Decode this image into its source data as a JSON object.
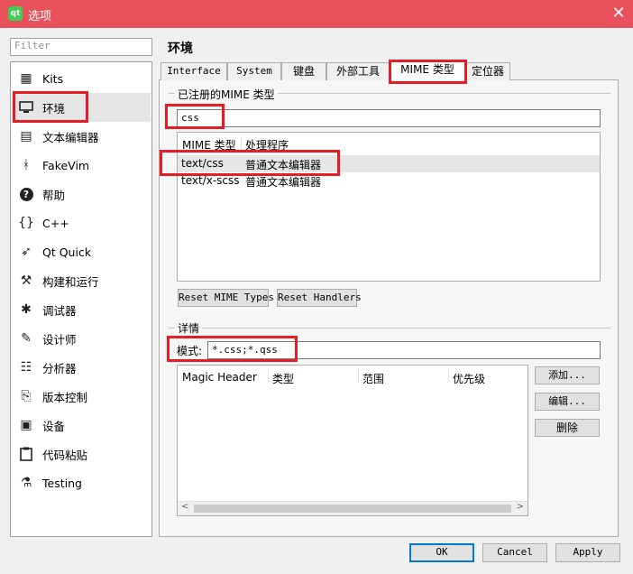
{
  "window": {
    "title": "选项",
    "app_icon": "qt-creator-icon",
    "close_glyph": "✕",
    "accent": "#e8505b"
  },
  "filter": {
    "placeholder": "Filter"
  },
  "sidebar": {
    "items": [
      {
        "label": "Kits",
        "icon": "kits-icon",
        "glyph": "▦"
      },
      {
        "label": "环境",
        "icon": "monitor-icon",
        "glyph": "▭",
        "selected": true
      },
      {
        "label": "文本编辑器",
        "icon": "text-editor-icon",
        "glyph": "▤"
      },
      {
        "label": "FakeVim",
        "icon": "fakevim-icon",
        "glyph": "ᚼ"
      },
      {
        "label": "帮助",
        "icon": "help-icon",
        "glyph": "?"
      },
      {
        "label": "C++",
        "icon": "cpp-braces-icon",
        "glyph": "{}"
      },
      {
        "label": "Qt Quick",
        "icon": "qtquick-icon",
        "glyph": "➶"
      },
      {
        "label": "构建和运行",
        "icon": "hammer-icon",
        "glyph": "⚒"
      },
      {
        "label": "调试器",
        "icon": "bug-icon",
        "glyph": "✱"
      },
      {
        "label": "设计师",
        "icon": "pencil-icon",
        "glyph": "✎"
      },
      {
        "label": "分析器",
        "icon": "analyzer-icon",
        "glyph": "☷"
      },
      {
        "label": "版本控制",
        "icon": "version-control-icon",
        "glyph": "⎘"
      },
      {
        "label": "设备",
        "icon": "device-icon",
        "glyph": "▣"
      },
      {
        "label": "代码粘贴",
        "icon": "code-paste-icon",
        "glyph": "📋"
      },
      {
        "label": "Testing",
        "icon": "flask-icon",
        "glyph": "⚗"
      }
    ]
  },
  "section_title": "环境",
  "tabs": [
    {
      "label": "Interface"
    },
    {
      "label": "System"
    },
    {
      "label": "键盘"
    },
    {
      "label": "外部工具"
    },
    {
      "label": "MIME 类型",
      "active": true
    },
    {
      "label": "定位器"
    }
  ],
  "registered": {
    "group_label": "已注册的MIME 类型",
    "search_value": "css",
    "columns": [
      "MIME 类型",
      "处理程序"
    ],
    "rows": [
      {
        "mime": "text/css",
        "handler": "普通文本编辑器",
        "selected": true
      },
      {
        "mime": "text/x-scss",
        "handler": "普通文本编辑器"
      }
    ],
    "reset_mime_label": "Reset MIME Types",
    "reset_handlers_label": "Reset Handlers"
  },
  "details": {
    "group_label": "详情",
    "pattern_label": "模式:",
    "pattern_value": "*.css;*.qss",
    "columns": [
      "Magic Header",
      "类型",
      "范围",
      "优先级"
    ],
    "add_label": "添加...",
    "edit_label": "编辑...",
    "delete_label": "删除",
    "scroll_left": "<",
    "scroll_right": ">"
  },
  "footer": {
    "ok_label": "OK",
    "cancel_label": "Cancel",
    "apply_label": "Apply"
  }
}
